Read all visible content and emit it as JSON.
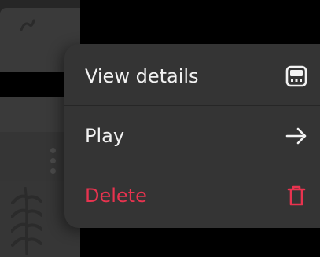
{
  "menu": {
    "items": [
      {
        "label": "View details",
        "icon": "details-panel-icon"
      },
      {
        "label": "Play",
        "icon": "arrow-right-icon"
      },
      {
        "label": "Delete",
        "icon": "trash-icon"
      }
    ]
  },
  "colors": {
    "menu_background": "#343434",
    "text": "#f2f2f2",
    "danger": "#e8334f",
    "backdrop": "#000000"
  }
}
